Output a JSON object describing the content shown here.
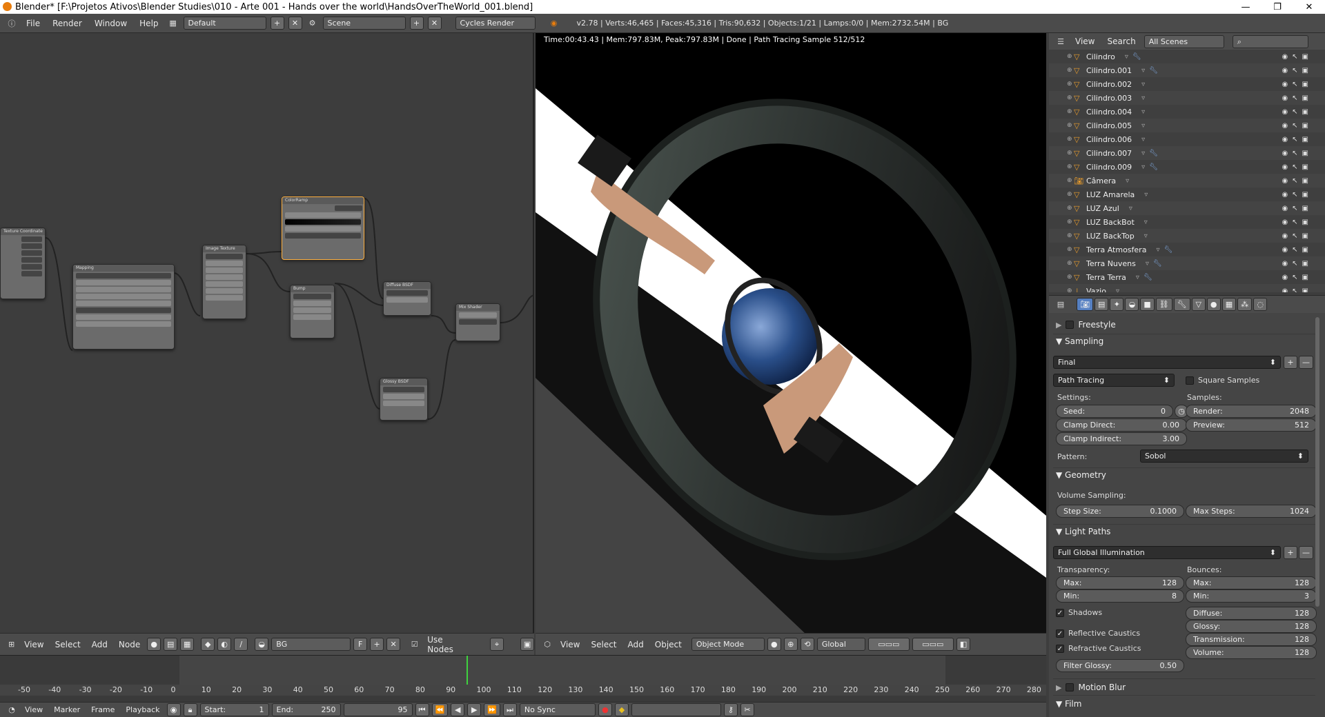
{
  "window": {
    "title": "Blender* [F:\\Projetos Ativos\\Blender Studies\\010 - Arte 001 - Hands over the world\\HandsOverTheWorld_001.blend]",
    "controls": [
      "—",
      "❐",
      "✕"
    ]
  },
  "infobar": {
    "menus": [
      "File",
      "Render",
      "Window",
      "Help"
    ],
    "layout": "Default",
    "scene": "Scene",
    "engine": "Cycles Render",
    "stats": "v2.78 | Verts:46,465 | Faces:45,316 | Tris:90,632 | Objects:1/21 | Lamps:0/0 | Mem:2732.54M | BG"
  },
  "node_editor": {
    "label": "BG",
    "menus": [
      "View",
      "Select",
      "Add",
      "Node"
    ],
    "material": "BG",
    "f_label": "F",
    "use_nodes": "Use Nodes",
    "nodes": [
      "Texture Coordinate",
      "Mapping",
      "Image Texture",
      "ColorRamp",
      "Bump",
      "Diffuse BSDF",
      "Mix Shader",
      "Glossy BSDF"
    ]
  },
  "viewport": {
    "render_info": "Time:00:43.43 | Mem:797.83M, Peak:797.83M | Done | Path Tracing Sample 512/512",
    "menus": [
      "View",
      "Select",
      "Add",
      "Object"
    ],
    "mode": "Object Mode",
    "orientation": "Global"
  },
  "timeline": {
    "ticks": [
      "-50",
      "-40",
      "-30",
      "-20",
      "-10",
      "0",
      "10",
      "20",
      "30",
      "40",
      "50",
      "60",
      "70",
      "80",
      "90",
      "100",
      "110",
      "120",
      "130",
      "140",
      "150",
      "160",
      "170",
      "180",
      "190",
      "200",
      "210",
      "220",
      "230",
      "240",
      "250",
      "260",
      "270",
      "280"
    ],
    "menus": [
      "View",
      "Marker",
      "Frame",
      "Playback"
    ],
    "start_label": "Start:",
    "start": "1",
    "end_label": "End:",
    "end": "250",
    "current": "95",
    "sync": "No Sync",
    "current_frame": 95
  },
  "outliner": {
    "menus": [
      "View",
      "Search"
    ],
    "filter": "All Scenes",
    "items": [
      {
        "name": "Cilindro",
        "icon": "mesh-icon",
        "mod": "wrench"
      },
      {
        "name": "Cilindro.001",
        "icon": "mesh-icon",
        "mod": "wrench"
      },
      {
        "name": "Cilindro.002",
        "icon": "mesh-icon",
        "mod": ""
      },
      {
        "name": "Cilindro.003",
        "icon": "mesh-icon",
        "mod": ""
      },
      {
        "name": "Cilindro.004",
        "icon": "mesh-icon",
        "mod": ""
      },
      {
        "name": "Cilindro.005",
        "icon": "mesh-icon",
        "mod": ""
      },
      {
        "name": "Cilindro.006",
        "icon": "mesh-icon",
        "mod": ""
      },
      {
        "name": "Cilindro.007",
        "icon": "mesh-icon",
        "mod": "wrench"
      },
      {
        "name": "Cilindro.009",
        "icon": "mesh-icon",
        "mod": "wrench"
      },
      {
        "name": "Câmera",
        "icon": "camera-icon",
        "mod": ""
      },
      {
        "name": "LUZ Amarela",
        "icon": "mesh-icon",
        "mod": ""
      },
      {
        "name": "LUZ Azul",
        "icon": "mesh-icon",
        "mod": ""
      },
      {
        "name": "LUZ BackBot",
        "icon": "mesh-icon",
        "mod": ""
      },
      {
        "name": "LUZ BackTop",
        "icon": "mesh-icon",
        "mod": ""
      },
      {
        "name": "Terra Atmosfera",
        "icon": "mesh-icon",
        "mod": "wrench"
      },
      {
        "name": "Terra Nuvens",
        "icon": "mesh-icon",
        "mod": "wrench"
      },
      {
        "name": "Terra Terra",
        "icon": "mesh-icon",
        "mod": "wrench"
      },
      {
        "name": "Vazio",
        "icon": "empty-icon",
        "mod": ""
      }
    ]
  },
  "properties": {
    "freestyle": "Freestyle",
    "sampling": {
      "title": "Sampling",
      "preset": "Final",
      "integrator": "Path Tracing",
      "square_samples": "Square Samples",
      "settings_label": "Settings:",
      "samples_label": "Samples:",
      "seed_label": "Seed:",
      "seed": "0",
      "clamp_direct_label": "Clamp Direct:",
      "clamp_direct": "0.00",
      "clamp_indirect_label": "Clamp Indirect:",
      "clamp_indirect": "3.00",
      "render_label": "Render:",
      "render": "2048",
      "preview_label": "Preview:",
      "preview": "512",
      "pattern_label": "Pattern:",
      "pattern": "Sobol"
    },
    "geometry": {
      "title": "Geometry",
      "volume_sampling": "Volume Sampling:",
      "step_size_label": "Step Size:",
      "step_size": "0.1000",
      "max_steps_label": "Max Steps:",
      "max_steps": "1024"
    },
    "light_paths": {
      "title": "Light Paths",
      "preset": "Full Global Illumination",
      "transparency_label": "Transparency:",
      "bounces_label": "Bounces:",
      "t_max_label": "Max:",
      "t_max": "128",
      "t_min_label": "Min:",
      "t_min": "8",
      "b_max_label": "Max:",
      "b_max": "128",
      "b_min_label": "Min:",
      "b_min": "3",
      "shadows": "Shadows",
      "diffuse_label": "Diffuse:",
      "diffuse": "128",
      "glossy_label": "Glossy:",
      "glossy": "128",
      "transmission_label": "Transmission:",
      "transmission": "128",
      "volume_label": "Volume:",
      "volume": "128",
      "reflective_caustics": "Reflective Caustics",
      "refractive_caustics": "Refractive Caustics",
      "filter_glossy_label": "Filter Glossy:",
      "filter_glossy": "0.50"
    },
    "motion_blur": "Motion Blur",
    "film": "Film"
  },
  "colors": {
    "accent": "#e87d0d",
    "selected_node": "#ffb040",
    "playhead": "#3fd33f"
  }
}
